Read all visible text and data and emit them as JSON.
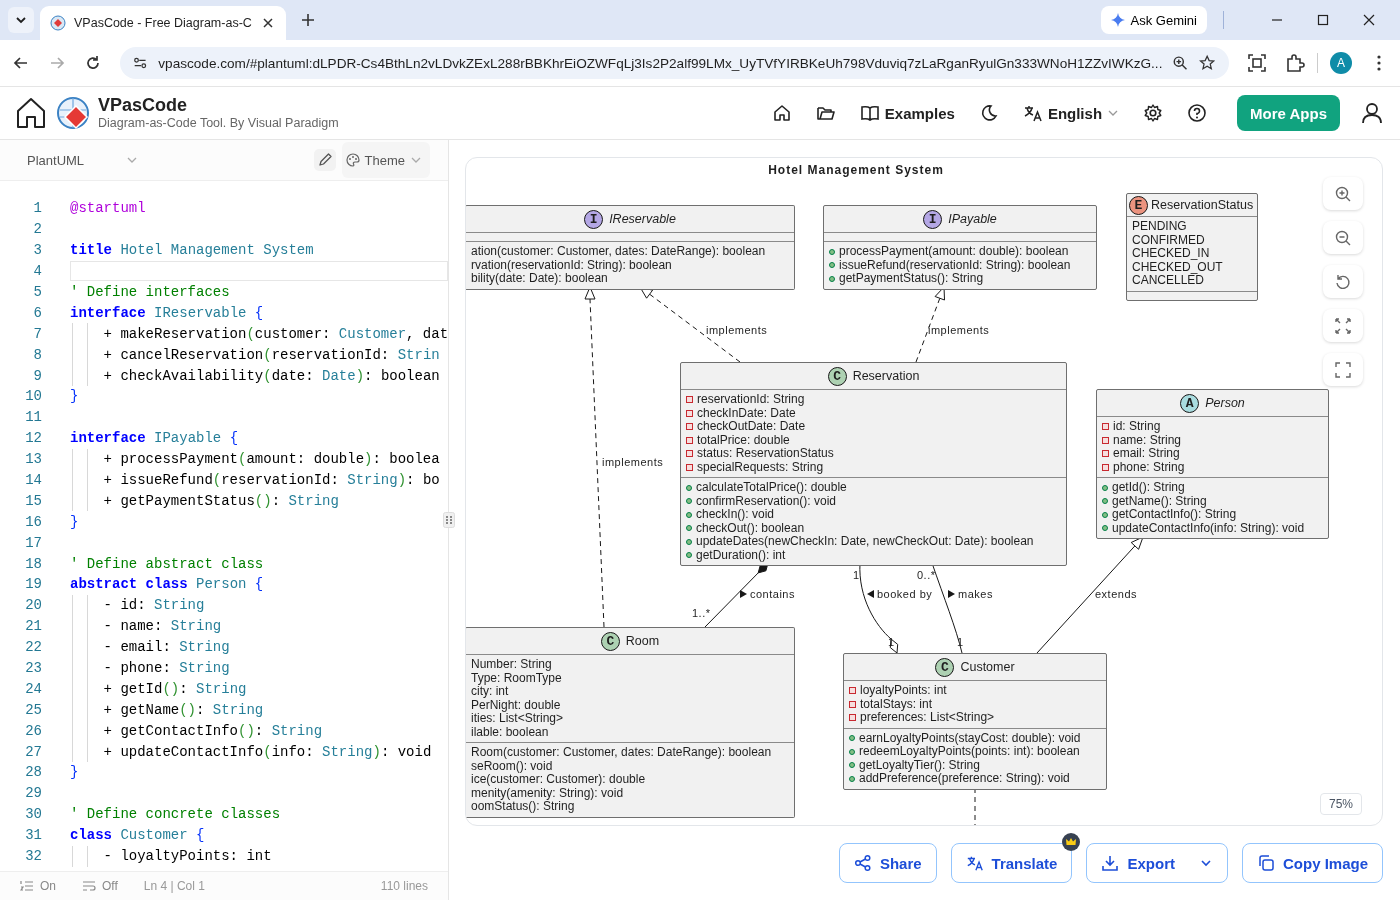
{
  "browser": {
    "tab_title": "VPasCode - Free Diagram-as-C",
    "ask_gemini": "Ask Gemini",
    "url": "vpascode.com/#plantuml:dLPDR-Cs4BthLn2vLDvkZExL288rBBKhrEiOZWFqLj3Is2P2alf99LMx_UyTVfYIRBKeUh798Vduviq7zLaRganRyulGn333WNoH1ZZvIWKzG...",
    "profile_initial": "A"
  },
  "app": {
    "name": "VPasCode",
    "tagline": "Diagram-as-Code Tool. By Visual Paradigm",
    "examples": "Examples",
    "language": "English",
    "more_apps": "More Apps"
  },
  "editor": {
    "syntax": "PlantUML",
    "theme": "Theme",
    "lines": [
      {
        "number": "1",
        "selected": false,
        "tokens": [
          {
            "kind": "directive",
            "text": "@startuml"
          }
        ]
      },
      {
        "number": "2",
        "selected": false
      },
      {
        "number": "3",
        "selected": false,
        "tokens": [
          {
            "kind": "keyword",
            "text": "title"
          },
          {
            "kind": "type",
            "text": " Hotel Management System"
          }
        ]
      },
      {
        "number": "4",
        "selected": true
      },
      {
        "number": "5",
        "selected": false,
        "tokens": [
          {
            "kind": "comment",
            "text": "' Define interfaces"
          }
        ]
      },
      {
        "number": "6",
        "selected": false,
        "tokens": [
          {
            "kind": "keyword",
            "text": "interface"
          },
          {
            "kind": "type",
            "text": " IReservable"
          },
          {
            "kind": "brace",
            "text": " {"
          }
        ],
        "children": [
          {
            "number": "7",
            "selected": false,
            "tokens": [
              {
                "kind": "plain",
                "text": "+ makeReservation"
              },
              {
                "kind": "paren",
                "text": "("
              },
              {
                "kind": "plain",
                "text": "customer: "
              },
              {
                "kind": "type",
                "text": "Customer"
              },
              {
                "kind": "plain",
                "text": ", dat"
              }
            ]
          },
          {
            "number": "8",
            "selected": false,
            "tokens": [
              {
                "kind": "plain",
                "text": "+ cancelReservation"
              },
              {
                "kind": "paren",
                "text": "("
              },
              {
                "kind": "plain",
                "text": "reservationId: "
              },
              {
                "kind": "type",
                "text": "Strin"
              }
            ]
          },
          {
            "number": "9",
            "selected": false,
            "tokens": [
              {
                "kind": "plain",
                "text": "+ checkAvailability"
              },
              {
                "kind": "paren",
                "text": "("
              },
              {
                "kind": "plain",
                "text": "date: "
              },
              {
                "kind": "type",
                "text": "Date"
              },
              {
                "kind": "paren",
                "text": ")"
              },
              {
                "kind": "plain",
                "text": ": boolean"
              }
            ]
          }
        ]
      },
      {
        "number": "10",
        "selected": false,
        "tokens": [
          {
            "kind": "brace",
            "text": "}"
          }
        ]
      },
      {
        "number": "11",
        "selected": false
      },
      {
        "number": "12",
        "selected": false,
        "tokens": [
          {
            "kind": "keyword",
            "text": "interface"
          },
          {
            "kind": "type",
            "text": " IPayable"
          },
          {
            "kind": "brace",
            "text": " {"
          }
        ],
        "children": [
          {
            "number": "13",
            "selected": false,
            "tokens": [
              {
                "kind": "plain",
                "text": "+ processPayment"
              },
              {
                "kind": "paren",
                "text": "("
              },
              {
                "kind": "plain",
                "text": "amount: double"
              },
              {
                "kind": "paren",
                "text": ")"
              },
              {
                "kind": "plain",
                "text": ": boolea"
              }
            ]
          },
          {
            "number": "14",
            "selected": false,
            "tokens": [
              {
                "kind": "plain",
                "text": "+ issueRefund"
              },
              {
                "kind": "paren",
                "text": "("
              },
              {
                "kind": "plain",
                "text": "reservationId: "
              },
              {
                "kind": "type",
                "text": "String"
              },
              {
                "kind": "paren",
                "text": ")"
              },
              {
                "kind": "plain",
                "text": ": bo"
              }
            ]
          },
          {
            "number": "15",
            "selected": false,
            "tokens": [
              {
                "kind": "plain",
                "text": "+ getPaymentStatus"
              },
              {
                "kind": "paren",
                "text": "()"
              },
              {
                "kind": "plain",
                "text": ": "
              },
              {
                "kind": "type",
                "text": "String"
              }
            ]
          }
        ]
      },
      {
        "number": "16",
        "selected": false,
        "tokens": [
          {
            "kind": "brace",
            "text": "}"
          }
        ]
      },
      {
        "number": "17",
        "selected": false
      },
      {
        "number": "18",
        "selected": false,
        "tokens": [
          {
            "kind": "comment",
            "text": "' Define abstract class"
          }
        ]
      },
      {
        "number": "19",
        "selected": false,
        "tokens": [
          {
            "kind": "keyword",
            "text": "abstract class"
          },
          {
            "kind": "type",
            "text": " Person"
          },
          {
            "kind": "brace",
            "text": " {"
          }
        ],
        "children": [
          {
            "number": "20",
            "selected": false,
            "tokens": [
              {
                "kind": "plain",
                "text": "- id: "
              },
              {
                "kind": "type",
                "text": "String"
              }
            ]
          },
          {
            "number": "21",
            "selected": false,
            "tokens": [
              {
                "kind": "plain",
                "text": "- name: "
              },
              {
                "kind": "type",
                "text": "String"
              }
            ]
          },
          {
            "number": "22",
            "selected": false,
            "tokens": [
              {
                "kind": "plain",
                "text": "- email: "
              },
              {
                "kind": "type",
                "text": "String"
              }
            ]
          },
          {
            "number": "23",
            "selected": false,
            "tokens": [
              {
                "kind": "plain",
                "text": "- phone: "
              },
              {
                "kind": "type",
                "text": "String"
              }
            ]
          },
          {
            "number": "24",
            "selected": false,
            "tokens": [
              {
                "kind": "plain",
                "text": "+ getId"
              },
              {
                "kind": "paren",
                "text": "()"
              },
              {
                "kind": "plain",
                "text": ": "
              },
              {
                "kind": "type",
                "text": "String"
              }
            ]
          },
          {
            "number": "25",
            "selected": false,
            "tokens": [
              {
                "kind": "plain",
                "text": "+ getName"
              },
              {
                "kind": "paren",
                "text": "()"
              },
              {
                "kind": "plain",
                "text": ": "
              },
              {
                "kind": "type",
                "text": "String"
              }
            ]
          },
          {
            "number": "26",
            "selected": false,
            "tokens": [
              {
                "kind": "plain",
                "text": "+ getContactInfo"
              },
              {
                "kind": "paren",
                "text": "()"
              },
              {
                "kind": "plain",
                "text": ": "
              },
              {
                "kind": "type",
                "text": "String"
              }
            ]
          },
          {
            "number": "27",
            "selected": false,
            "tokens": [
              {
                "kind": "plain",
                "text": "+ updateContactInfo"
              },
              {
                "kind": "paren",
                "text": "("
              },
              {
                "kind": "plain",
                "text": "info: "
              },
              {
                "kind": "type",
                "text": "String"
              },
              {
                "kind": "paren",
                "text": ")"
              },
              {
                "kind": "plain",
                "text": ": void"
              }
            ]
          }
        ]
      },
      {
        "number": "28",
        "selected": false,
        "tokens": [
          {
            "kind": "brace",
            "text": "}"
          }
        ]
      },
      {
        "number": "29",
        "selected": false
      },
      {
        "number": "30",
        "selected": false,
        "tokens": [
          {
            "kind": "comment",
            "text": "' Define concrete classes"
          }
        ]
      },
      {
        "number": "31",
        "selected": false,
        "tokens": [
          {
            "kind": "keyword",
            "text": "class"
          },
          {
            "kind": "type",
            "text": " Customer"
          },
          {
            "kind": "brace",
            "text": " {"
          }
        ],
        "children": [
          {
            "number": "32",
            "selected": false,
            "tokens": [
              {
                "kind": "plain",
                "text": "- loyaltyPoints: int"
              }
            ]
          }
        ]
      }
    ],
    "status": {
      "line_numbers": "On",
      "word_wrap": "Off",
      "position": "Ln 4 | Col 1",
      "total": "110 lines"
    }
  },
  "diagram": {
    "title": "Hotel Management System",
    "classes": [
      {
        "kind": "interface",
        "letter": "I",
        "name": "IReservable",
        "methods": [
          {
            "text": "ation(customer: Customer, dates: DateRange): boolean"
          },
          {
            "text": "rvation(reservationId: String): boolean"
          },
          {
            "text": "bility(date: Date): boolean"
          }
        ]
      },
      {
        "kind": "interface",
        "letter": "I",
        "name": "IPayable",
        "methods": [
          {
            "kind": "public",
            "text": "processPayment(amount: double): boolean"
          },
          {
            "kind": "public",
            "text": "issueRefund(reservationId: String): boolean"
          },
          {
            "kind": "public",
            "text": "getPaymentStatus(): String"
          }
        ]
      },
      {
        "kind": "enum",
        "letter": "E",
        "name": "ReservationStatus",
        "attributes": [
          {
            "text": "PENDING"
          },
          {
            "text": "CONFIRMED"
          },
          {
            "text": "CHECKED_IN"
          },
          {
            "text": "CHECKED_OUT"
          },
          {
            "text": "CANCELLED"
          }
        ]
      },
      {
        "kind": "class",
        "letter": "C",
        "name": "Reservation",
        "attributes": [
          {
            "kind": "private",
            "text": "reservationId: String"
          },
          {
            "kind": "private",
            "text": "checkInDate: Date"
          },
          {
            "kind": "private",
            "text": "checkOutDate: Date"
          },
          {
            "kind": "private",
            "text": "totalPrice: double"
          },
          {
            "kind": "private",
            "text": "status: ReservationStatus"
          },
          {
            "kind": "private",
            "text": "specialRequests: String"
          }
        ],
        "methods": [
          {
            "kind": "public",
            "text": "calculateTotalPrice(): double"
          },
          {
            "kind": "public",
            "text": "confirmReservation(): void"
          },
          {
            "kind": "public",
            "text": "checkIn(): void"
          },
          {
            "kind": "public",
            "text": "checkOut(): boolean"
          },
          {
            "kind": "public",
            "text": "updateDates(newCheckIn: Date, newCheckOut: Date): boolean"
          },
          {
            "kind": "public",
            "text": "getDuration(): int"
          }
        ]
      },
      {
        "kind": "abstract",
        "letter": "A",
        "name": "Person",
        "attributes": [
          {
            "kind": "private",
            "text": "id: String"
          },
          {
            "kind": "private",
            "text": "name: String"
          },
          {
            "kind": "private",
            "text": "email: String"
          },
          {
            "kind": "private",
            "text": "phone: String"
          }
        ],
        "methods": [
          {
            "kind": "public",
            "text": "getId(): String"
          },
          {
            "kind": "public",
            "text": "getName(): String"
          },
          {
            "kind": "public",
            "text": "getContactInfo(): String"
          },
          {
            "kind": "public",
            "text": "updateContactInfo(info: String): void"
          }
        ]
      },
      {
        "kind": "class",
        "letter": "C",
        "name": "Room",
        "attributes": [
          {
            "text": "Number: String"
          },
          {
            "text": "Type: RoomType"
          },
          {
            "text": "city: int"
          },
          {
            "text": "PerNight: double"
          },
          {
            "text": "ities: List<String>"
          },
          {
            "text": "ilable: boolean"
          }
        ],
        "methods": [
          {
            "text": "Room(customer: Customer, dates: DateRange): boolean"
          },
          {
            "text": "seRoom(): void"
          },
          {
            "text": "ice(customer: Customer): double"
          },
          {
            "text": "menity(amenity: String): void"
          },
          {
            "text": "oomStatus(): String"
          }
        ]
      },
      {
        "kind": "class",
        "letter": "C",
        "name": "Customer",
        "attributes": [
          {
            "kind": "private",
            "text": "loyaltyPoints: int"
          },
          {
            "kind": "private",
            "text": "totalStays: int"
          },
          {
            "kind": "private",
            "text": "preferences: List<String>"
          }
        ],
        "methods": [
          {
            "kind": "public",
            "text": "earnLoyaltyPoints(stayCost: double): void"
          },
          {
            "kind": "public",
            "text": "redeemLoyaltyPoints(points: int): boolean"
          },
          {
            "kind": "public",
            "text": "getLoyaltyTier(): String"
          },
          {
            "kind": "public",
            "text": "addPreference(preference: String): void"
          }
        ]
      }
    ],
    "relations": [
      {
        "kind": "realization",
        "label": "implements"
      },
      {
        "kind": "realization",
        "label": "implements"
      },
      {
        "kind": "realization",
        "label": "implements"
      },
      {
        "kind": "composition",
        "label": "contains",
        "arrow_reversed": false,
        "multiplicity_target": "1..*"
      },
      {
        "kind": "aggregation",
        "label": "booked by",
        "arrow_reversed": true,
        "multiplicity_source": "1",
        "multiplicity_target": "1"
      },
      {
        "kind": "association",
        "label": "makes",
        "arrow_reversed": false,
        "multiplicity_source": "0..*",
        "multiplicity_target": "1"
      },
      {
        "kind": "generalization",
        "label": "extends"
      },
      {
        "kind": "dependency"
      }
    ],
    "zoom": "75%"
  },
  "actions": [
    {
      "kind": "share",
      "label": "Share",
      "premium": false
    },
    {
      "kind": "translate",
      "label": "Translate",
      "premium": true
    },
    {
      "kind": "export",
      "label": "Export",
      "premium": false
    },
    {
      "kind": "copy",
      "label": "Copy Image",
      "premium": false
    }
  ]
}
